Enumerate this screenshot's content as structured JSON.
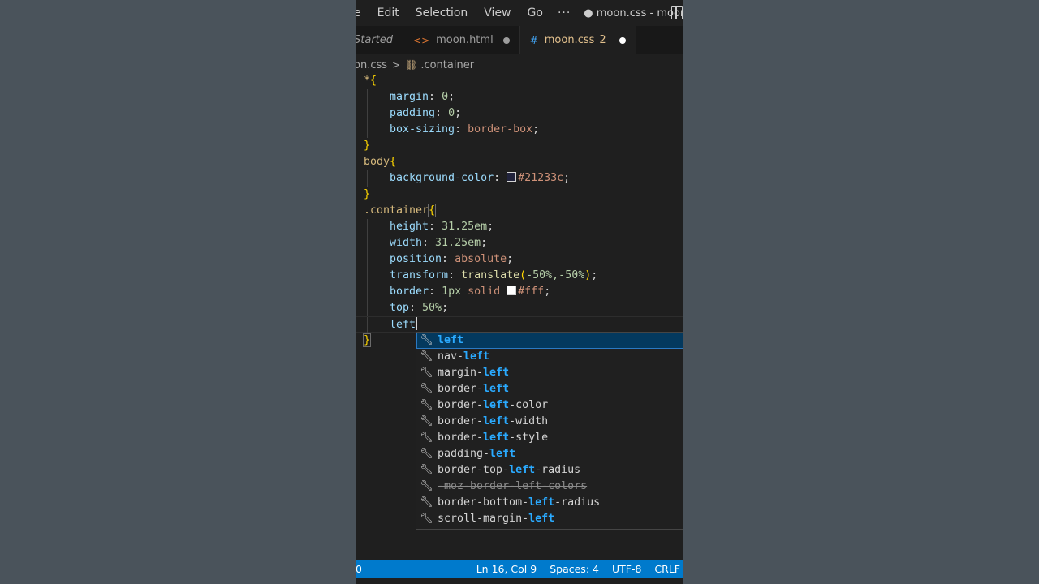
{
  "menubar": {
    "items": [
      "e",
      "Edit",
      "Selection",
      "View",
      "Go"
    ],
    "more": "···",
    "title": "● moon.css - moon - Vi..."
  },
  "tabs": [
    {
      "label": "Started"
    },
    {
      "label": "moon.html",
      "icon": "<>"
    },
    {
      "label": "moon.css",
      "icon": "#",
      "badge": "2"
    }
  ],
  "breadcrumb": {
    "file": "on.css",
    "separator": ">",
    "symbol": ".container"
  },
  "code": {
    "l1_sel": "*",
    "l1_brace": "{",
    "l2_prop": "margin",
    "l2_val": "0",
    "l3_prop": "padding",
    "l3_val": "0",
    "l4_prop": "box-sizing",
    "l4_val": "border-box",
    "l5_brace": "}",
    "l6_sel": "body",
    "l6_brace": "{",
    "l7_prop": "background-color",
    "l7_val": "#21233c",
    "l8_brace": "}",
    "l9_sel": ".container",
    "l9_brace": "{",
    "l10_prop": "height",
    "l10_val": "31.25em",
    "l11_prop": "width",
    "l11_val": "31.25em",
    "l12_prop": "position",
    "l12_val": "absolute",
    "l13_prop": "transform",
    "l13_fn": "translate",
    "l13_args": "-50%,-50%",
    "l14_prop": "border",
    "l14_val1": "1px",
    "l14_val2": "solid",
    "l14_color": "#fff",
    "l15_prop": "top",
    "l15_val": "50%",
    "l16_text": "left",
    "l17_brace": "}"
  },
  "suggestions": [
    {
      "pre": "",
      "match": "left",
      "post": ""
    },
    {
      "pre": "nav-",
      "match": "left",
      "post": ""
    },
    {
      "pre": "margin-",
      "match": "left",
      "post": ""
    },
    {
      "pre": "border-",
      "match": "left",
      "post": ""
    },
    {
      "pre": "border-",
      "match": "left",
      "post": "-color"
    },
    {
      "pre": "border-",
      "match": "left",
      "post": "-width"
    },
    {
      "pre": "border-",
      "match": "left",
      "post": "-style"
    },
    {
      "pre": "padding-",
      "match": "left",
      "post": ""
    },
    {
      "pre": "border-top-",
      "match": "left",
      "post": "-radius"
    },
    {
      "label": "-moz-border-left-colors",
      "deprecated": true
    },
    {
      "pre": "border-bottom-",
      "match": "left",
      "post": "-radius"
    },
    {
      "pre": "scroll-margin-",
      "match": "left",
      "post": ""
    }
  ],
  "statusbar": {
    "problems": "0",
    "position": "Ln 16, Col 9",
    "spaces": "Spaces: 4",
    "encoding": "UTF-8",
    "eol": "CRLF"
  },
  "colors": {
    "status_bar": "#007acc",
    "body_swatch": "#21233c",
    "border_swatch": "#ffffff"
  }
}
